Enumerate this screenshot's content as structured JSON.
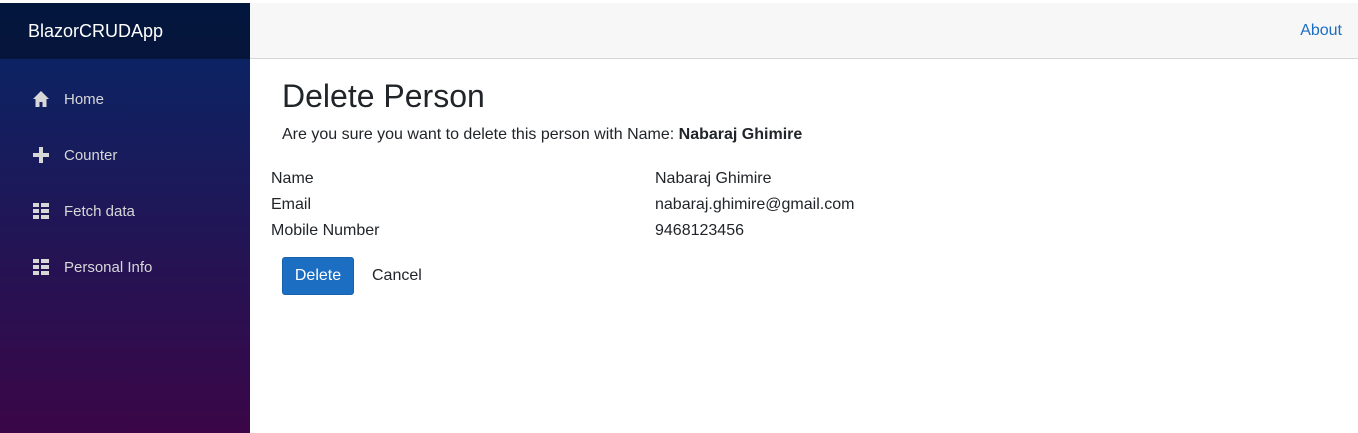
{
  "app": {
    "brand": "BlazorCRUDApp"
  },
  "sidebar": {
    "items": [
      {
        "label": "Home",
        "icon": "home-icon"
      },
      {
        "label": "Counter",
        "icon": "plus-icon"
      },
      {
        "label": "Fetch data",
        "icon": "list-icon"
      },
      {
        "label": "Personal Info",
        "icon": "list-icon"
      }
    ]
  },
  "topbar": {
    "about_label": "About"
  },
  "page": {
    "title": "Delete Person",
    "confirm_prefix": "Are you sure you want to delete this person with Name: ",
    "confirm_name": "Nabaraj Ghimire",
    "fields": [
      {
        "label": "Name",
        "value": "Nabaraj Ghimire"
      },
      {
        "label": "Email",
        "value": "nabaraj.ghimire@gmail.com"
      },
      {
        "label": "Mobile Number",
        "value": "9468123456"
      }
    ],
    "delete_label": "Delete",
    "cancel_label": "Cancel"
  },
  "colors": {
    "accent": "#1b6ec2",
    "sidebar_top": "#052767",
    "sidebar_bottom": "#3a0647"
  }
}
